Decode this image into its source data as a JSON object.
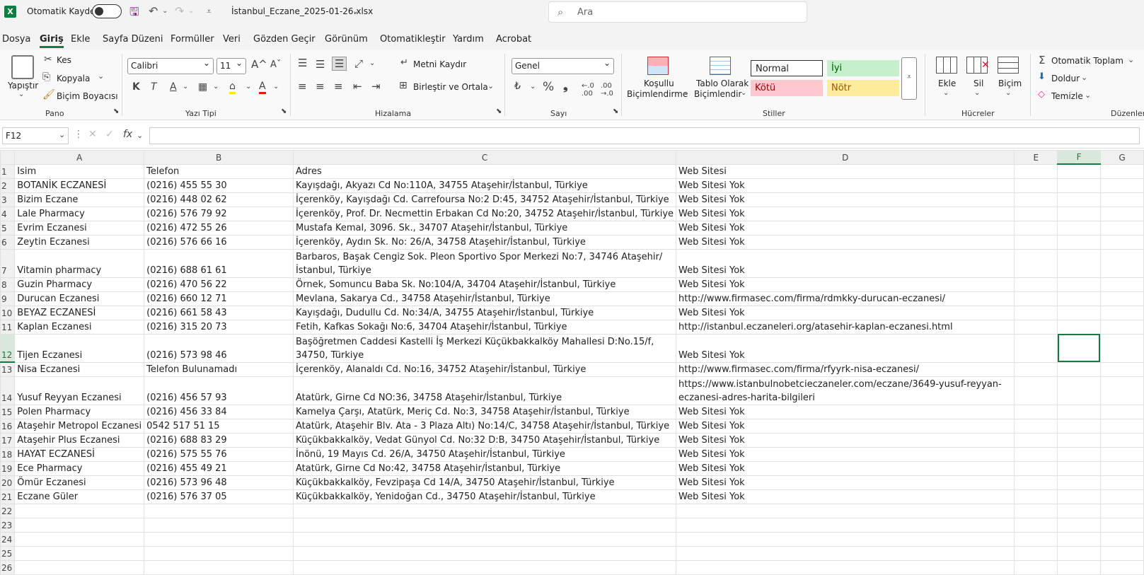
{
  "title_bar": {
    "logo": "X",
    "autosave_label": "Otomatik Kaydet",
    "filename": "İstanbul_Eczane_2025-01-26.xlsx",
    "search_placeholder": "Ara"
  },
  "menu": {
    "tabs": [
      "Dosya",
      "Giriş",
      "Ekle",
      "Sayfa Düzeni",
      "Formüller",
      "Veri",
      "Gözden Geçir",
      "Görünüm",
      "Otomatikleştir",
      "Yardım",
      "Acrobat"
    ],
    "active": "Giriş"
  },
  "ribbon": {
    "clipboard": {
      "paste": "Yapıştır",
      "cut": "Kes",
      "copy": "Kopyala",
      "format_painter": "Biçim Boyacısı",
      "label": "Pano"
    },
    "font": {
      "name": "Calibri",
      "size": "11",
      "label": "Yazı Tipi"
    },
    "alignment": {
      "wrap": "Metni Kaydır",
      "merge": "Birleştir ve Ortala",
      "label": "Hizalama"
    },
    "number": {
      "format": "Genel",
      "label": "Sayı"
    },
    "styles": {
      "conditional_1": "Koşullu",
      "conditional_2": "Biçimlendirme",
      "table_1": "Tablo Olarak",
      "table_2": "Biçimlendir",
      "normal": "Normal",
      "good": "İyi",
      "bad": "Kötü",
      "neutral": "Nötr",
      "label": "Stiller"
    },
    "cells": {
      "insert": "Ekle",
      "delete": "Sil",
      "format": "Biçim",
      "label": "Hücreler"
    },
    "editing": {
      "autosum": "Otomatik Toplam",
      "fill": "Doldur",
      "clear": "Temizle",
      "label": "Düzenler"
    }
  },
  "formula_bar": {
    "name_box": "F12",
    "fx": "fx",
    "formula": ""
  },
  "sheet": {
    "columns": [
      "A",
      "B",
      "C",
      "D",
      "E",
      "F",
      "G"
    ],
    "selected_column": "F",
    "selected_row": 12,
    "rows": [
      {
        "n": "1",
        "a": "Isim",
        "b": "Telefon",
        "c": "Adres",
        "d": "Web Sitesi"
      },
      {
        "n": "2",
        "a": "BOTANİK ECZANESİ",
        "b": "(0216) 455 55 30",
        "c": "Kayışdağı, Akyazı Cd No:110A, 34755 Ataşehir/İstanbul, Türkiye",
        "d": "Web Sitesi Yok"
      },
      {
        "n": "3",
        "a": "Bizim Eczane",
        "b": "(0216) 448 02 62",
        "c": "İçerenköy, Kayışdağı Cd. Carrefoursa No:2 D:45, 34752 Ataşehir/İstanbul, Türkiye",
        "d": "Web Sitesi Yok"
      },
      {
        "n": "4",
        "a": "Lale Pharmacy",
        "b": "(0216) 576 79 92",
        "c": "İçerenköy, Prof. Dr. Necmettin Erbakan Cd No:20, 34752 Ataşehir/İstanbul, Türkiye",
        "d": "Web Sitesi Yok"
      },
      {
        "n": "5",
        "a": "Evrim Eczanesi",
        "b": "(0216) 472 55 26",
        "c": "Mustafa Kemal, 3096. Sk., 34707 Ataşehir/İstanbul, Türkiye",
        "d": "Web Sitesi Yok"
      },
      {
        "n": "6",
        "a": "Zeytin Eczanesi",
        "b": "(0216) 576 66 16",
        "c": "İçerenköy, Aydın Sk. No: 26/A, 34758 Ataşehir/İstanbul, Türkiye",
        "d": "Web Sitesi Yok"
      },
      {
        "n": "7",
        "a": "Vitamin pharmacy",
        "b": "(0216) 688 61 61",
        "c": "Barbaros, Başak Cengiz Sok. Pleon Sportivo Spor Merkezi No:7, 34746 Ataşehir/İstanbul, Türkiye",
        "d": "Web Sitesi Yok",
        "wrap": true
      },
      {
        "n": "8",
        "a": "Guzin Pharmacy",
        "b": "(0216) 470 56 22",
        "c": "Örnek, Somuncu Baba Sk. No:104/A, 34704 Ataşehir/İstanbul, Türkiye",
        "d": "Web Sitesi Yok"
      },
      {
        "n": "9",
        "a": "Durucan Eczanesi",
        "b": "(0216) 660 12 71",
        "c": "Mevlana, Sakarya Cd., 34758 Ataşehir/İstanbul, Türkiye",
        "d": "http://www.firmasec.com/firma/rdmkky-durucan-eczanesi/"
      },
      {
        "n": "10",
        "a": "BEYAZ ECZANESİ",
        "b": "(0216) 661 58 43",
        "c": "Kayışdağı, Dudullu Cd. No:34/A, 34755 Ataşehir/İstanbul, Türkiye",
        "d": "Web Sitesi Yok"
      },
      {
        "n": "11",
        "a": "Kaplan Eczanesi",
        "b": "(0216) 315 20 73",
        "c": "Fetih, Kafkas Sokağı No:6, 34704 Ataşehir/İstanbul, Türkiye",
        "d": "http://istanbul.eczaneleri.org/atasehir-kaplan-eczanesi.html"
      },
      {
        "n": "12",
        "a": "Tijen Eczanesi",
        "b": "(0216) 573 98 46",
        "c": "Başöğretmen Caddesi Kastelli İş Merkezi Küçükbakkalköy Mahallesi D:No.15/f, 34750, Türkiye",
        "d": "Web Sitesi Yok",
        "wrap": true
      },
      {
        "n": "13",
        "a": "Nisa Eczanesi",
        "b": "Telefon Bulunamadı",
        "c": "İçerenköy, Alanaldı Cd. No:16, 34752 Ataşehir/İstanbul, Türkiye",
        "d": "http://www.firmasec.com/firma/rfyyrk-nisa-eczanesi/"
      },
      {
        "n": "14",
        "a": "Yusuf Reyyan Eczanesi",
        "b": "(0216) 456 57 93",
        "c": "Atatürk, Girne Cd NO:36, 34758 Ataşehir/İstanbul, Türkiye",
        "d": "https://www.istanbulnobetcieczaneler.com/eczane/3649-yusuf-reyyan-eczanesi-adres-harita-bilgileri",
        "wrap": true
      },
      {
        "n": "15",
        "a": "Polen Pharmacy",
        "b": "(0216) 456 33 84",
        "c": "Kamelya Çarşı, Atatürk, Meriç Cd. No:3, 34758 Ataşehir/İstanbul, Türkiye",
        "d": "Web Sitesi Yok"
      },
      {
        "n": "16",
        "a": "Ataşehir Metropol Eczanesi",
        "b": "0542 517 51 15",
        "c": "Atatürk, Ataşehir Blv. Ata - 3 Plaza Altı) No:14/C, 34758 Ataşehir/İstanbul, Türkiye",
        "d": "Web Sitesi Yok"
      },
      {
        "n": "17",
        "a": "Ataşehir Plus Eczanesi",
        "b": "(0216) 688 83 29",
        "c": "Küçükbakkalköy, Vedat Günyol Cd. No:32 D:B, 34750 Ataşehir/İstanbul, Türkiye",
        "d": "Web Sitesi Yok"
      },
      {
        "n": "18",
        "a": "HAYAT ECZANESİ",
        "b": "(0216) 575 55 76",
        "c": "İnönü, 19 Mayıs Cd. 26/A, 34750 Ataşehir/İstanbul, Türkiye",
        "d": "Web Sitesi Yok"
      },
      {
        "n": "19",
        "a": "Ece Pharmacy",
        "b": "(0216) 455 49 21",
        "c": "Atatürk, Girne Cd No:42, 34758 Ataşehir/İstanbul, Türkiye",
        "d": "Web Sitesi Yok"
      },
      {
        "n": "20",
        "a": "Ömür Eczanesi",
        "b": "(0216) 573 96 48",
        "c": "Küçükbakkalköy, Fevzipaşa Cd 14/A, 34750 Ataşehir/İstanbul, Türkiye",
        "d": "Web Sitesi Yok"
      },
      {
        "n": "21",
        "a": "Eczane Güler",
        "b": "(0216) 576 37 05",
        "c": "Küçükbakkalköy, Yenidoğan Cd., 34750 Ataşehir/İstanbul, Türkiye",
        "d": "Web Sitesi Yok"
      },
      {
        "n": "22",
        "a": "",
        "b": "",
        "c": "",
        "d": ""
      },
      {
        "n": "23",
        "a": "",
        "b": "",
        "c": "",
        "d": ""
      },
      {
        "n": "24",
        "a": "",
        "b": "",
        "c": "",
        "d": ""
      },
      {
        "n": "25",
        "a": "",
        "b": "",
        "c": "",
        "d": ""
      },
      {
        "n": "26",
        "a": "",
        "b": "",
        "c": "",
        "d": ""
      }
    ]
  }
}
